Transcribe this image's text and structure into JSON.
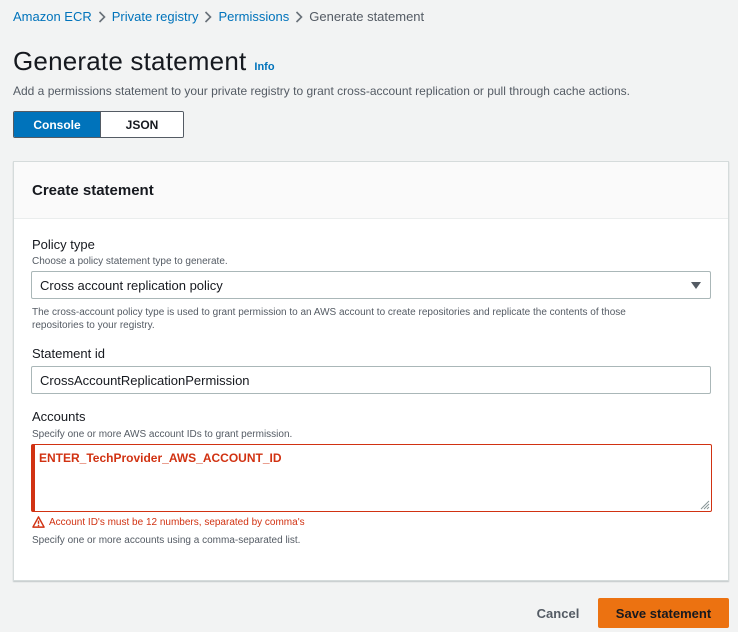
{
  "breadcrumb": {
    "items": [
      "Amazon ECR",
      "Private registry",
      "Permissions"
    ],
    "current": "Generate statement"
  },
  "page": {
    "title": "Generate statement",
    "info": "Info",
    "description": "Add a permissions statement to your private registry to grant cross-account replication or pull through cache actions."
  },
  "mode_toggle": {
    "options": [
      "Console",
      "JSON"
    ],
    "selected": "Console"
  },
  "panel": {
    "title": "Create statement",
    "policy_type": {
      "label": "Policy type",
      "hint": "Choose a policy statement type to generate.",
      "value": "Cross account replication policy",
      "help_line1": "The cross-account policy type is used to grant permission to an AWS account to create repositories and replicate the contents of those",
      "help_line2": "repositories to your registry."
    },
    "statement_id": {
      "label": "Statement id",
      "value": "CrossAccountReplicationPermission"
    },
    "accounts": {
      "label": "Accounts",
      "hint": "Specify one or more AWS account IDs to grant permission.",
      "value": "ENTER_TechProvider_AWS_ACCOUNT_ID",
      "error": "Account ID's must be 12 numbers, separated by comma's",
      "constraint": "Specify one or more accounts using a comma-separated list."
    }
  },
  "actions": {
    "cancel": "Cancel",
    "save": "Save statement"
  },
  "colors": {
    "link": "#0073bb",
    "error": "#d13212",
    "primary_button": "#ec7211",
    "background": "#f2f3f3"
  }
}
